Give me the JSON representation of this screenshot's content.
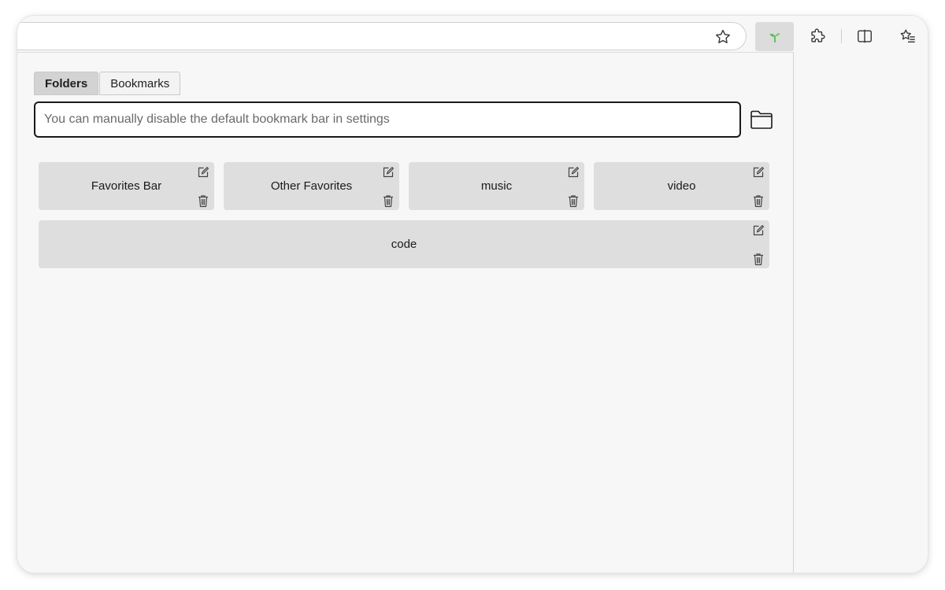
{
  "toolbar": {
    "address_value": "",
    "icons": [
      "favorite-star-icon",
      "sprout-extension-icon",
      "puzzle-extensions-icon",
      "split-screen-icon",
      "favorites-list-icon"
    ],
    "extension_accent": "#5cb85c"
  },
  "popup": {
    "tabs": [
      {
        "label": "Folders",
        "active": true
      },
      {
        "label": "Bookmarks",
        "active": false
      }
    ],
    "search": {
      "value": "",
      "placeholder": "You can manually disable the default bookmark bar in settings"
    },
    "folders": [
      {
        "name": "Favorites Bar"
      },
      {
        "name": "Other Favorites"
      },
      {
        "name": "music"
      },
      {
        "name": "video"
      },
      {
        "name": "code"
      }
    ],
    "icons": {
      "folder": "folder-icon",
      "edit": "edit-icon",
      "delete": "trash-icon"
    }
  },
  "colors": {
    "card_bg": "#dedede",
    "active_tab_bg": "#d3d3d3",
    "panel_bg": "#f7f7f7"
  }
}
